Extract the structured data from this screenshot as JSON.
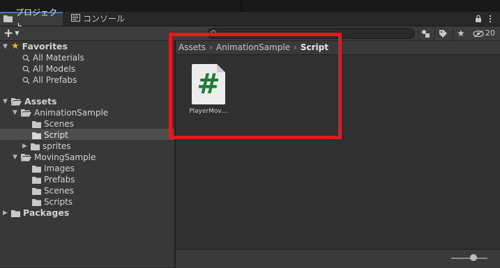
{
  "tabs": [
    {
      "label": "プロジェクト",
      "icon": "folder-icon",
      "active": true
    },
    {
      "label": "コンソール",
      "icon": "console-icon",
      "active": false
    }
  ],
  "tab_controls": {
    "lock_icon": "lock-icon",
    "menu_icon": "kebab-menu-icon"
  },
  "toolbar": {
    "create_label": "+",
    "search_placeholder": "",
    "hidden_count": "20"
  },
  "favorites": {
    "label": "Favorites",
    "items": [
      "All Materials",
      "All Models",
      "All Prefabs"
    ]
  },
  "tree": {
    "assets": "Assets",
    "animation_sample": "AnimationSample",
    "scenes": "Scenes",
    "script": "Script",
    "sprites": "sprites",
    "moving_sample": "MovingSample",
    "images": "Images",
    "prefabs": "Prefabs",
    "scenes2": "Scenes",
    "scripts": "Scripts",
    "packages": "Packages"
  },
  "breadcrumb": [
    "Assets",
    "AnimationSample",
    "Script"
  ],
  "asset": {
    "label": "PlayerMov…",
    "icon": "csharp-script-icon",
    "glyph": "#"
  },
  "colors": {
    "accent": "#3a79bb",
    "highlight": "#e8161e",
    "csharp": "#1f7a33"
  }
}
